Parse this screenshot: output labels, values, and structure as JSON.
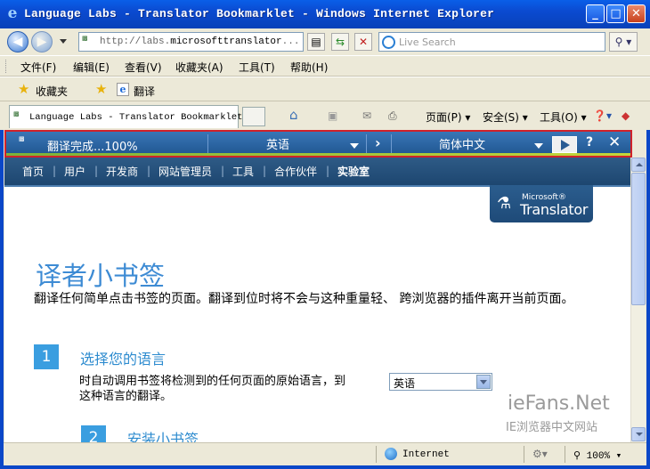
{
  "window": {
    "title": "Language Labs - Translator Bookmarklet - Windows Internet Explorer",
    "minimize": "_",
    "maximize": "□",
    "close": "✕"
  },
  "address": {
    "url_prefix": "http://labs.",
    "url_domain": "microsofttranslator",
    "url_suffix": "...",
    "search_placeholder": "Live Search"
  },
  "menu": [
    "文件(F)",
    "编辑(E)",
    "查看(V)",
    "收藏夹(A)",
    "工具(T)",
    "帮助(H)"
  ],
  "favorites": {
    "label": "收藏夹",
    "item": "翻译"
  },
  "tab": {
    "title": "Language Labs - Translator Bookmarklet"
  },
  "commands": {
    "page": "页面(P)",
    "safety": "安全(S)",
    "tools": "工具(O)"
  },
  "translator": {
    "status": "翻译完成...100%",
    "from_lang": "英语",
    "to_lang": "简体中文",
    "help": "?",
    "close": "✕"
  },
  "site_nav": [
    "首页",
    "用户",
    "开发商",
    "网站管理员",
    "工具",
    "合作伙伴",
    "实验室"
  ],
  "logo": {
    "brand": "Microsoft®",
    "product": "Translator"
  },
  "page": {
    "heading": "译者小书签",
    "intro": "翻译任何简单点击书签的页面。翻译到位时将不会与这种重量轻、 跨浏览器的插件离开当前页面。",
    "steps": [
      {
        "number": "1",
        "title": "选择您的语言",
        "description": "时自动调用书签将检测到的任何页面的原始语言，到这种语言的翻译。",
        "select_value": "英语"
      },
      {
        "number": "2",
        "title": "安装小书签"
      }
    ]
  },
  "watermark": {
    "line1": "ieFans.Net",
    "line2": "IE浏览器中文网站"
  },
  "status": {
    "zone": "Internet",
    "zoom": "100%"
  },
  "colors": {
    "translator_bar": "#1f5590",
    "highlight_border": "#d0222a",
    "heading": "#3d8bd4",
    "step_badge": "#3a9ee0"
  }
}
